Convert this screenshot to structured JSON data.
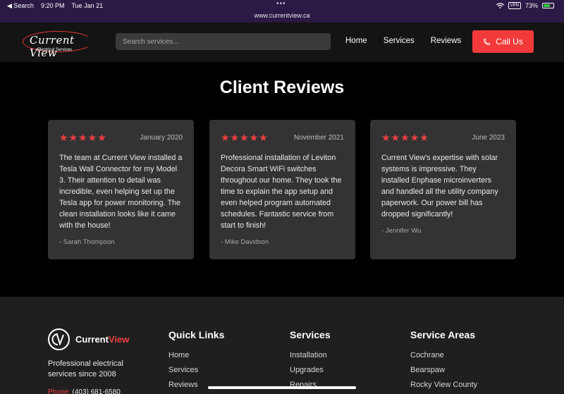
{
  "status": {
    "back_label": "◀ Search",
    "time": "9:20 PM",
    "date": "Tue Jan 21",
    "vpn": "VPN",
    "battery": "73%",
    "battery_level": 0.73,
    "url": "www.currentview.ca"
  },
  "nav": {
    "logo_text": "Current View",
    "logo_sub": "Electrical Services",
    "search_placeholder": "Search services...",
    "links": [
      "Home",
      "Services",
      "Reviews"
    ],
    "call_label": "Call Us"
  },
  "reviews": {
    "title": "Client Reviews",
    "items": [
      {
        "stars": "★★★★★",
        "date": "January 2020",
        "text": "The team at Current View installed a Tesla Wall Connector for my Model 3. Their attention to detail was incredible, even helping set up the Tesla app for power monitoring. The clean installation looks like it came with the house!",
        "author": "- Sarah Thompson"
      },
      {
        "stars": "★★★★★",
        "date": "November 2021",
        "text": "Professional installation of Leviton Decora Smart WiFi switches throughout our home. They took the time to explain the app setup and even helped program automated schedules. Fantastic service from start to finish!",
        "author": "- Mike Davidson"
      },
      {
        "stars": "★★★★★",
        "date": "June 2023",
        "text": "Current View's expertise with solar systems is impressive. They installed Enphase microinverters and handled all the utility company paperwork. Our power bill has dropped significantly!",
        "author": "- Jennifer Wu"
      }
    ]
  },
  "footer": {
    "brand_a": "Current",
    "brand_b": "View",
    "tagline": "Professional electrical services since 2008",
    "phone_label": "Phone:",
    "phone": "(403) 681-6580",
    "quick_links": {
      "title": "Quick Links",
      "items": [
        "Home",
        "Services",
        "Reviews"
      ]
    },
    "services": {
      "title": "Services",
      "items": [
        "Installation",
        "Upgrades",
        "Repairs"
      ]
    },
    "areas": {
      "title": "Service Areas",
      "items": [
        "Cochrane",
        "Bearspaw",
        "Rocky View County"
      ]
    }
  },
  "colors": {
    "accent": "#f23a3a",
    "background": "#000000",
    "card": "#333333",
    "footer": "#1f1f1f"
  }
}
